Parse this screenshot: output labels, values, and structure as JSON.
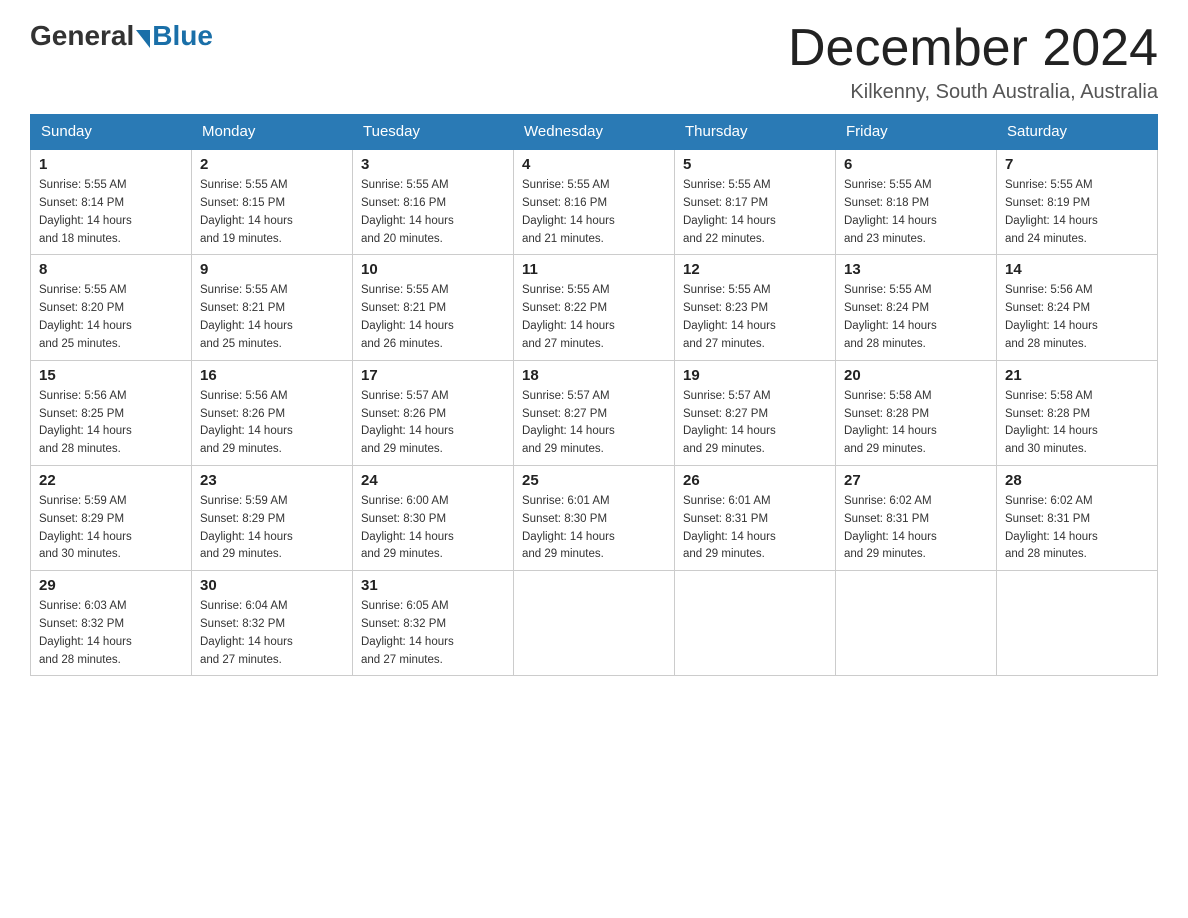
{
  "logo": {
    "general": "General",
    "blue": "Blue"
  },
  "header": {
    "month": "December 2024",
    "location": "Kilkenny, South Australia, Australia"
  },
  "weekdays": [
    "Sunday",
    "Monday",
    "Tuesday",
    "Wednesday",
    "Thursday",
    "Friday",
    "Saturday"
  ],
  "weeks": [
    [
      {
        "day": "1",
        "sunrise": "5:55 AM",
        "sunset": "8:14 PM",
        "daylight": "14 hours and 18 minutes."
      },
      {
        "day": "2",
        "sunrise": "5:55 AM",
        "sunset": "8:15 PM",
        "daylight": "14 hours and 19 minutes."
      },
      {
        "day": "3",
        "sunrise": "5:55 AM",
        "sunset": "8:16 PM",
        "daylight": "14 hours and 20 minutes."
      },
      {
        "day": "4",
        "sunrise": "5:55 AM",
        "sunset": "8:16 PM",
        "daylight": "14 hours and 21 minutes."
      },
      {
        "day": "5",
        "sunrise": "5:55 AM",
        "sunset": "8:17 PM",
        "daylight": "14 hours and 22 minutes."
      },
      {
        "day": "6",
        "sunrise": "5:55 AM",
        "sunset": "8:18 PM",
        "daylight": "14 hours and 23 minutes."
      },
      {
        "day": "7",
        "sunrise": "5:55 AM",
        "sunset": "8:19 PM",
        "daylight": "14 hours and 24 minutes."
      }
    ],
    [
      {
        "day": "8",
        "sunrise": "5:55 AM",
        "sunset": "8:20 PM",
        "daylight": "14 hours and 25 minutes."
      },
      {
        "day": "9",
        "sunrise": "5:55 AM",
        "sunset": "8:21 PM",
        "daylight": "14 hours and 25 minutes."
      },
      {
        "day": "10",
        "sunrise": "5:55 AM",
        "sunset": "8:21 PM",
        "daylight": "14 hours and 26 minutes."
      },
      {
        "day": "11",
        "sunrise": "5:55 AM",
        "sunset": "8:22 PM",
        "daylight": "14 hours and 27 minutes."
      },
      {
        "day": "12",
        "sunrise": "5:55 AM",
        "sunset": "8:23 PM",
        "daylight": "14 hours and 27 minutes."
      },
      {
        "day": "13",
        "sunrise": "5:55 AM",
        "sunset": "8:24 PM",
        "daylight": "14 hours and 28 minutes."
      },
      {
        "day": "14",
        "sunrise": "5:56 AM",
        "sunset": "8:24 PM",
        "daylight": "14 hours and 28 minutes."
      }
    ],
    [
      {
        "day": "15",
        "sunrise": "5:56 AM",
        "sunset": "8:25 PM",
        "daylight": "14 hours and 28 minutes."
      },
      {
        "day": "16",
        "sunrise": "5:56 AM",
        "sunset": "8:26 PM",
        "daylight": "14 hours and 29 minutes."
      },
      {
        "day": "17",
        "sunrise": "5:57 AM",
        "sunset": "8:26 PM",
        "daylight": "14 hours and 29 minutes."
      },
      {
        "day": "18",
        "sunrise": "5:57 AM",
        "sunset": "8:27 PM",
        "daylight": "14 hours and 29 minutes."
      },
      {
        "day": "19",
        "sunrise": "5:57 AM",
        "sunset": "8:27 PM",
        "daylight": "14 hours and 29 minutes."
      },
      {
        "day": "20",
        "sunrise": "5:58 AM",
        "sunset": "8:28 PM",
        "daylight": "14 hours and 29 minutes."
      },
      {
        "day": "21",
        "sunrise": "5:58 AM",
        "sunset": "8:28 PM",
        "daylight": "14 hours and 30 minutes."
      }
    ],
    [
      {
        "day": "22",
        "sunrise": "5:59 AM",
        "sunset": "8:29 PM",
        "daylight": "14 hours and 30 minutes."
      },
      {
        "day": "23",
        "sunrise": "5:59 AM",
        "sunset": "8:29 PM",
        "daylight": "14 hours and 29 minutes."
      },
      {
        "day": "24",
        "sunrise": "6:00 AM",
        "sunset": "8:30 PM",
        "daylight": "14 hours and 29 minutes."
      },
      {
        "day": "25",
        "sunrise": "6:01 AM",
        "sunset": "8:30 PM",
        "daylight": "14 hours and 29 minutes."
      },
      {
        "day": "26",
        "sunrise": "6:01 AM",
        "sunset": "8:31 PM",
        "daylight": "14 hours and 29 minutes."
      },
      {
        "day": "27",
        "sunrise": "6:02 AM",
        "sunset": "8:31 PM",
        "daylight": "14 hours and 29 minutes."
      },
      {
        "day": "28",
        "sunrise": "6:02 AM",
        "sunset": "8:31 PM",
        "daylight": "14 hours and 28 minutes."
      }
    ],
    [
      {
        "day": "29",
        "sunrise": "6:03 AM",
        "sunset": "8:32 PM",
        "daylight": "14 hours and 28 minutes."
      },
      {
        "day": "30",
        "sunrise": "6:04 AM",
        "sunset": "8:32 PM",
        "daylight": "14 hours and 27 minutes."
      },
      {
        "day": "31",
        "sunrise": "6:05 AM",
        "sunset": "8:32 PM",
        "daylight": "14 hours and 27 minutes."
      },
      null,
      null,
      null,
      null
    ]
  ],
  "labels": {
    "sunrise": "Sunrise:",
    "sunset": "Sunset:",
    "daylight": "Daylight:"
  }
}
